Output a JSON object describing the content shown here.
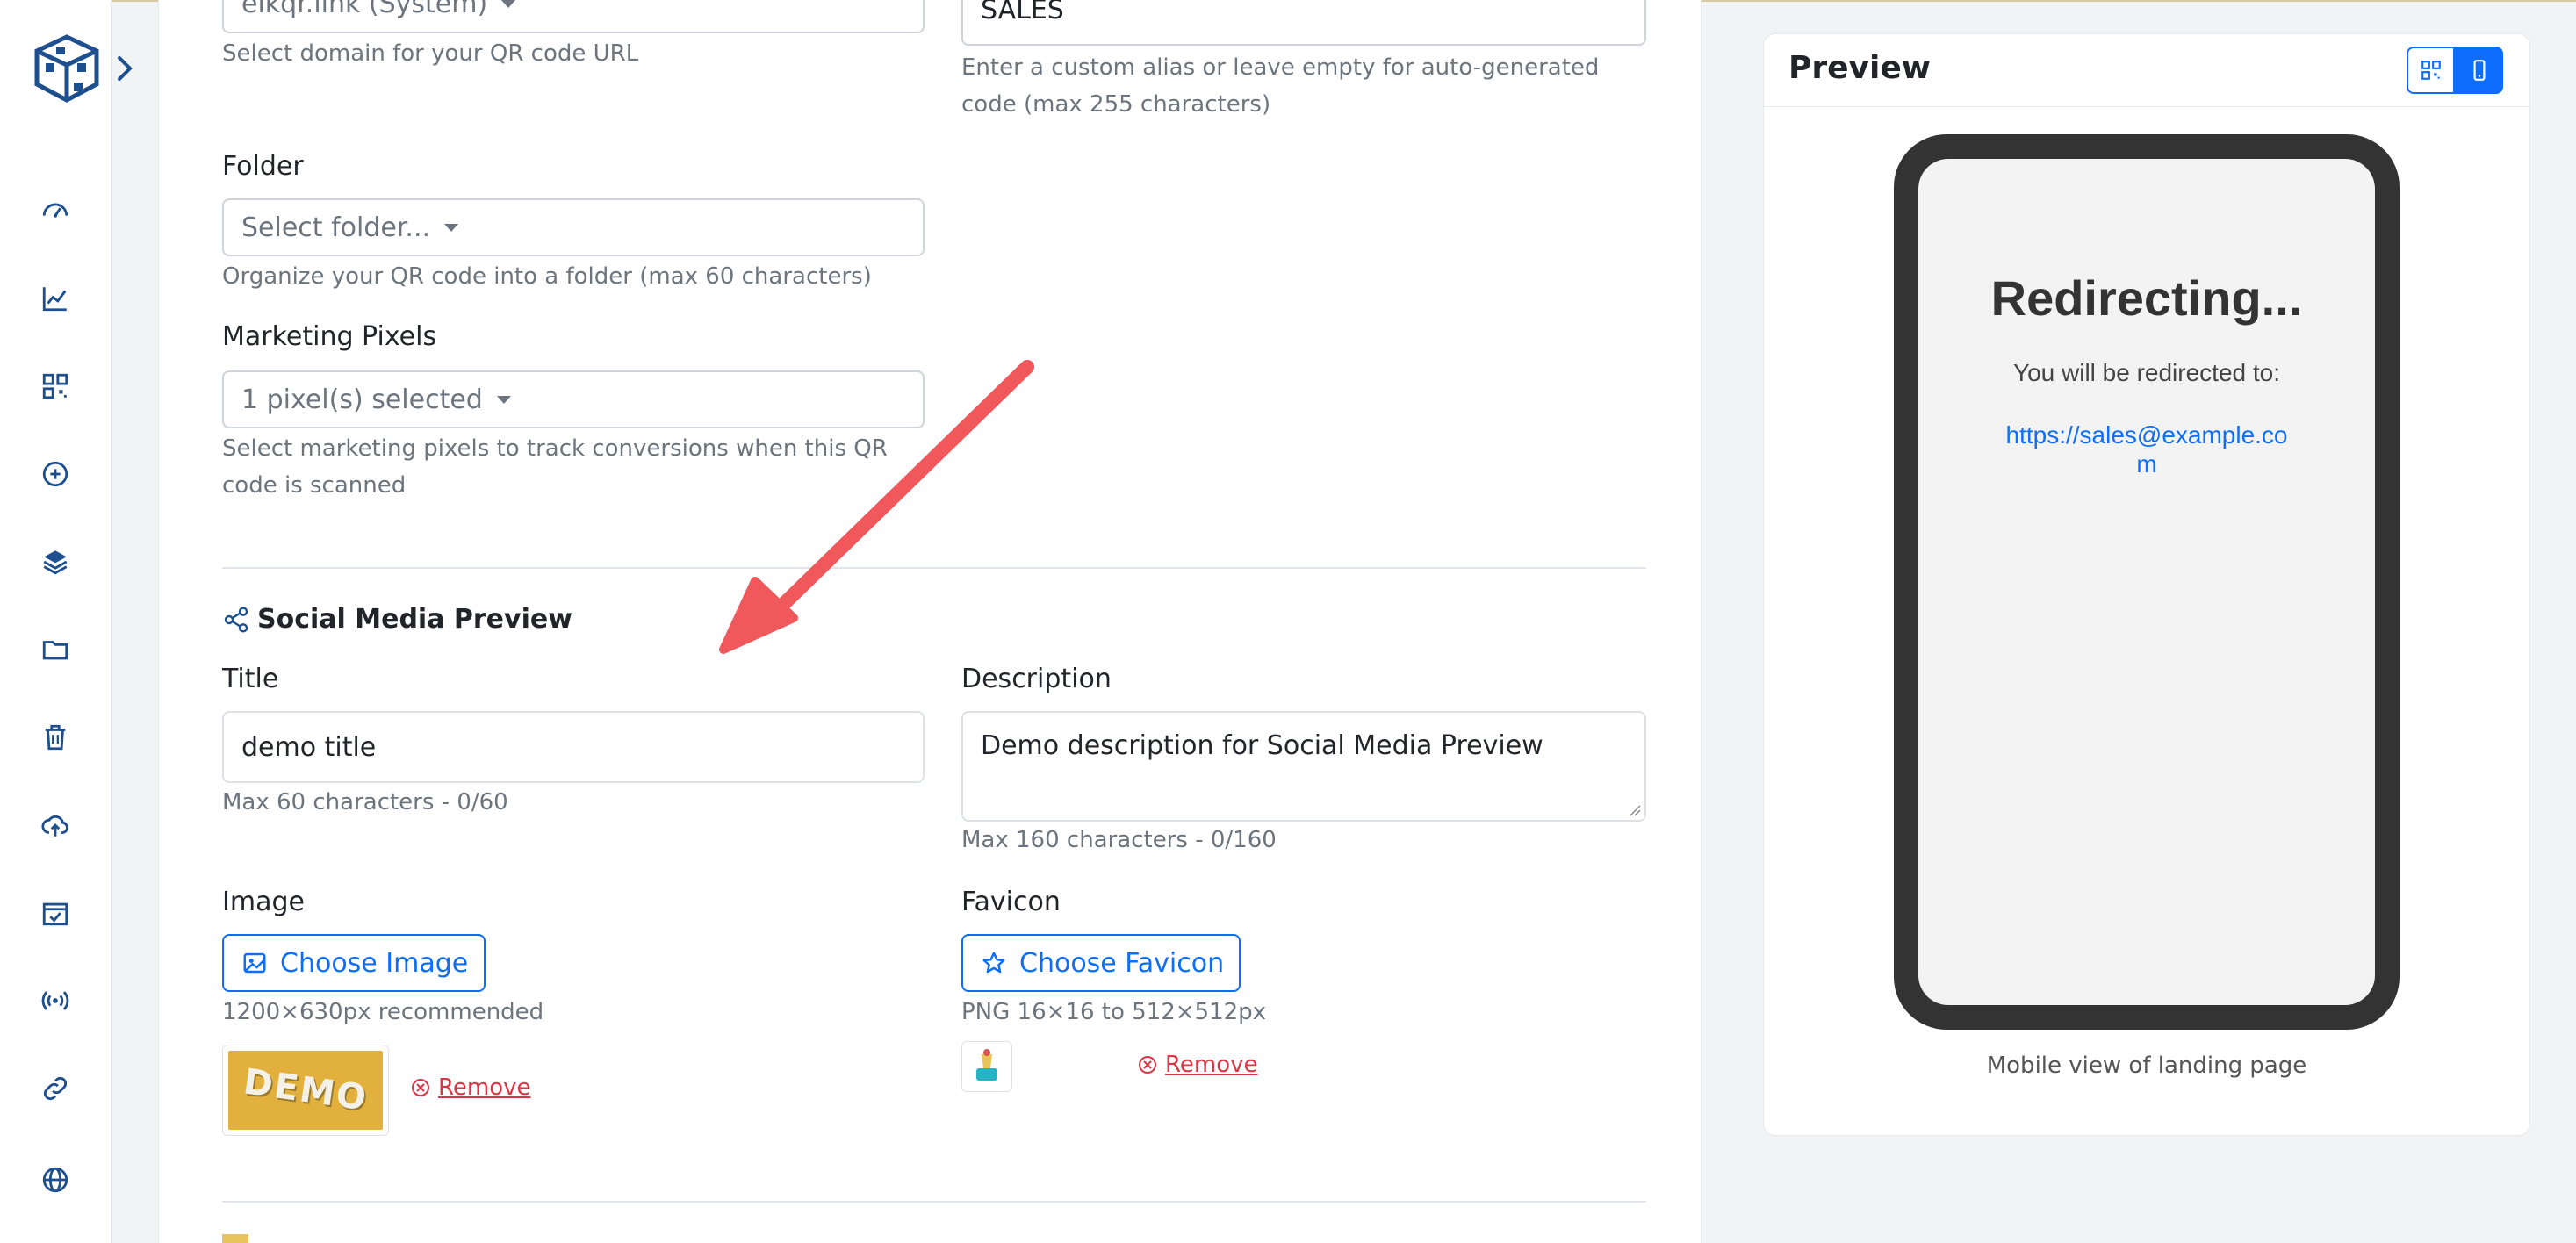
{
  "sidebar": {
    "logo_icon": "qr-cube-logo-icon",
    "expand_icon": "chevron-right-icon",
    "items": [
      {
        "icon": "dashboard-icon"
      },
      {
        "icon": "analytics-icon"
      },
      {
        "icon": "qr-code-icon"
      },
      {
        "icon": "add-circle-icon"
      },
      {
        "icon": "layers-icon"
      },
      {
        "icon": "folder-icon"
      },
      {
        "icon": "trash-icon"
      },
      {
        "icon": "cloud-upload-icon"
      },
      {
        "icon": "calendar-check-icon"
      },
      {
        "icon": "broadcast-icon"
      },
      {
        "icon": "link-icon"
      },
      {
        "icon": "globe-icon"
      }
    ]
  },
  "form": {
    "domain": {
      "value": "elkqr.link (System)",
      "help": "Select domain for your QR code URL"
    },
    "alias": {
      "value": "SALES",
      "help": "Enter a custom alias or leave empty for auto-generated code (max 255 characters)"
    },
    "folder": {
      "label": "Folder",
      "value": "Select folder...",
      "help": "Organize your QR code into a folder (max 60 characters)"
    },
    "pixels": {
      "label": "Marketing Pixels",
      "value": "1 pixel(s) selected",
      "help": "Select marketing pixels to track conversions when this QR code is scanned"
    },
    "social": {
      "heading": "Social Media Preview",
      "title_label": "Title",
      "title_value": "demo title",
      "title_help": "Max 60 characters - 0/60",
      "desc_label": "Description",
      "desc_value": "Demo description for Social Media Preview",
      "desc_help": "Max 160 characters - 0/160",
      "image_label": "Image",
      "image_button": "Choose Image",
      "image_help": "1200×630px recommended",
      "image_thumb_text": "DEMO",
      "favicon_label": "Favicon",
      "favicon_button": "Choose Favicon",
      "favicon_help": "PNG 16×16 to 512×512px",
      "remove_label": "Remove"
    }
  },
  "preview": {
    "title": "Preview",
    "toggle_qr_icon": "qr-code-icon",
    "toggle_mobile_icon": "mobile-phone-icon",
    "redirect_title": "Redirecting...",
    "redirect_sub": "You will be redirected to:",
    "redirect_url": "https://sales@example.com",
    "caption": "Mobile view of landing page"
  },
  "colors": {
    "accent": "#0d6efd",
    "danger": "#dc3545",
    "arrow": "#f0585c",
    "phone": "#333333"
  }
}
